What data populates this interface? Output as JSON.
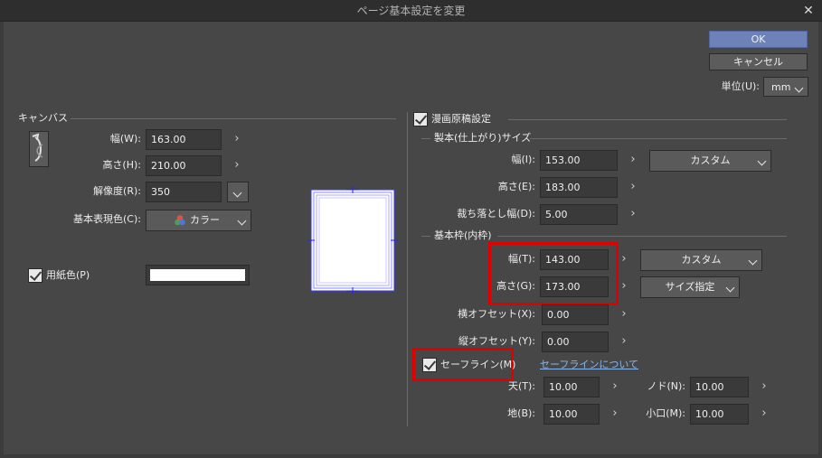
{
  "window": {
    "title": "ページ基本設定を変更",
    "close": "✕"
  },
  "buttons": {
    "ok": "OK",
    "cancel": "キャンセル"
  },
  "unit": {
    "label": "単位(U):",
    "value": "mm"
  },
  "canvas": {
    "section": "キャンバス",
    "width": {
      "label": "幅(W):",
      "value": "163.00"
    },
    "height": {
      "label": "高さ(H):",
      "value": "210.00"
    },
    "resolution": {
      "label": "解像度(R):",
      "value": "350"
    },
    "color_mode": {
      "label": "基本表現色(C):",
      "value": "カラー"
    },
    "paper_color": {
      "label": "用紙色(P)",
      "swatch": "#ffffff"
    }
  },
  "manga": {
    "section": "漫画原稿設定",
    "trim": {
      "section": "製本(仕上がり)サイズ",
      "width": {
        "label": "幅(I):",
        "value": "153.00"
      },
      "preset": "カスタム",
      "height": {
        "label": "高さ(E):",
        "value": "183.00"
      },
      "bleed": {
        "label": "裁ち落とし幅(D):",
        "value": "5.00"
      }
    },
    "inner": {
      "section": "基本枠(内枠)",
      "width": {
        "label": "幅(T):",
        "value": "143.00"
      },
      "preset": "カスタム",
      "height": {
        "label": "高さ(G):",
        "value": "173.00"
      },
      "size_mode": "サイズ指定",
      "hoffset": {
        "label": "横オフセット(X):",
        "value": "0.00"
      },
      "voffset": {
        "label": "縦オフセット(Y):",
        "value": "0.00"
      }
    },
    "safe": {
      "label": "セーフライン(M)",
      "link": "セーフラインについて",
      "top": {
        "label": "天(T):",
        "value": "10.00"
      },
      "gutter": {
        "label": "ノド(N):",
        "value": "10.00"
      },
      "bottom": {
        "label": "地(B):",
        "value": "10.00"
      },
      "fore": {
        "label": "小口(M):",
        "value": "10.00"
      }
    }
  },
  "arrow_glyph": "›",
  "colors": {
    "highlight": "#e00000",
    "primary_button": "#6d82b8",
    "link": "#86b7f0"
  }
}
